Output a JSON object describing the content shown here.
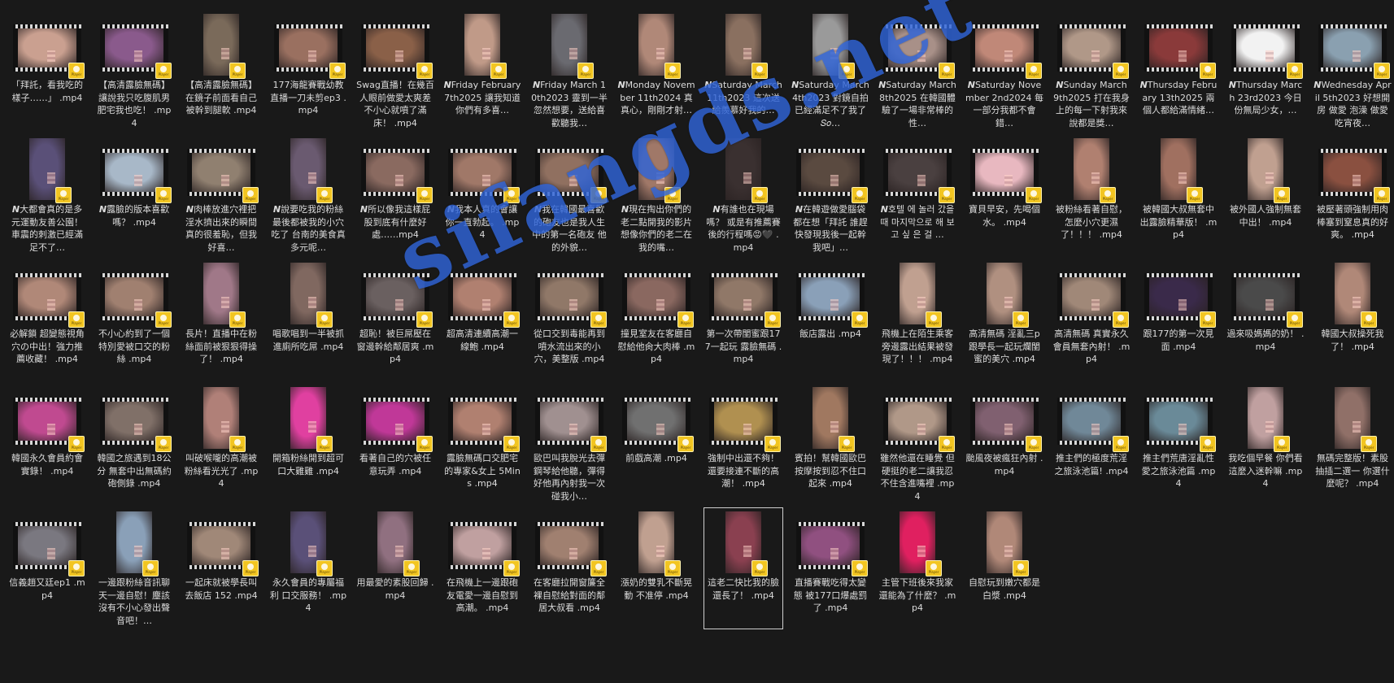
{
  "watermark": "sifangds.net",
  "badge_text": "Player",
  "files": [
    {
      "name": "「拜託，看我吃的樣子……」 .mp4",
      "shape": "land",
      "color": "#caa090"
    },
    {
      "name": "【高清露臉無碼】讓說我只吃腹肌男 肥宅我也吃！ .mp4",
      "shape": "land",
      "color": "#8a5a8c"
    },
    {
      "name": "【高清露臉無碼】在鏡子前面看自己被幹到腿軟 .mp4",
      "shape": "port",
      "color": "#7a6a5a"
    },
    {
      "name": "177海龍賽戰幼教直播一刀未剪ep3 .mp4",
      "shape": "land",
      "color": "#9a7060"
    },
    {
      "name": "Swag直播！在幾百人眼前做愛太爽差不小心就噴了滿床！ .mp4",
      "shape": "land",
      "color": "#8a6048"
    },
    {
      "name": "𝙉Friday February 7th2025 讓我知道你們有多喜…",
      "shape": "port",
      "color": "#c09a88"
    },
    {
      "name": "𝙉Friday March 10th2023 靈到一半忽然想要，送給喜歡聽我…",
      "shape": "port",
      "color": "#6a6a70"
    },
    {
      "name": "𝙉Monday November 11th2024 真真心，剛剛才射…",
      "shape": "port",
      "color": "#b08878"
    },
    {
      "name": "𝙉Saturday March 11th2023 這次送給羨慕好我的…",
      "shape": "port",
      "color": "#8a7060"
    },
    {
      "name": "𝙉Saturday March 4th2023 對鏡自拍已經滿足不了我了 𝑆𝑜…",
      "shape": "port",
      "color": "#9a9a9a"
    },
    {
      "name": "𝙉Saturday March 8th2025 在韓國體驗了一場非常棒的性…",
      "shape": "land",
      "color": "#a89088"
    },
    {
      "name": "𝙉Saturday November 2nd2024 每一部分我都不會錯…",
      "shape": "land",
      "color": "#c08878"
    },
    {
      "name": "𝙉Sunday March 9th2025 打在我身上的每一下射我來說都是獎…",
      "shape": "land",
      "color": "#b09888"
    },
    {
      "name": "𝙉Thursday February 13th2025 兩個人都給滿情緒…",
      "shape": "land",
      "color": "#8a3a3a"
    },
    {
      "name": "𝙉Thursday March 23rd2023 今日份無局少女，…",
      "shape": "land",
      "color": "#f2f2f2"
    },
    {
      "name": "𝙉Wednesday April 5th2023 好想開房 做愛 泡澡 做愛 吃宵夜…",
      "shape": "land",
      "color": "#8aa0b0"
    },
    {
      "name": "𝙉大都會真的是多元運動友善公園！ 車震的刺激已經滿足不了…",
      "shape": "port",
      "color": "#5a5078"
    },
    {
      "name": "𝙉露臉的版本喜歡嗎？ .mp4",
      "shape": "land",
      "color": "#a8b8c8"
    },
    {
      "name": "𝙉肉棒放進穴裡把淫水擠出來的瞬間真的很羞恥，但我好喜…",
      "shape": "land",
      "color": "#908070"
    },
    {
      "name": "𝙉說要吃我的粉絲最後都被我的小穴吃了 台南的美食真多元呢…",
      "shape": "port",
      "color": "#6a5a70"
    },
    {
      "name": "𝙉所以像我這樣屁股到底有什麼好處……mp4",
      "shape": "land",
      "color": "#8a6a60"
    },
    {
      "name": "𝙉我本人真的會讓你一直勃起。 .mp4",
      "shape": "land",
      "color": "#a07868"
    },
    {
      "name": "𝙉我在韓國最喜歡的砲友也是我人生中的第一名砲友 他的外貌…",
      "shape": "land",
      "color": "#907060"
    },
    {
      "name": "𝙉現在掏出你們的老二點開我的影片 想像你們的老二在我的嘴…",
      "shape": "port",
      "color": "#a07868"
    },
    {
      "name": "𝙉有誰也在現場嗎？ 或是有推薦賽後的行程嗎😡🖤 .mp4",
      "shape": "port",
      "color": "#3a3030"
    },
    {
      "name": "𝙉在韓遊做愛腦袋都在想「拜託 誰趕快發現我後一起幹我吧」…",
      "shape": "land",
      "color": "#5a4a40"
    },
    {
      "name": "𝙉호텔 에 놀러 갔을 때 마지막으로 해 보고 싶 은 걸 …",
      "shape": "land",
      "color": "#4a4040"
    },
    {
      "name": "寶貝早安，先喝個水。 .mp4",
      "shape": "land",
      "color": "#e8b8c0"
    },
    {
      "name": "被粉絲看著自慰，怎麼小穴更濕了！！！ .mp4",
      "shape": "port",
      "color": "#b08070"
    },
    {
      "name": "被韓國大叔無套中出露臉精華版！ .mp4",
      "shape": "port",
      "color": "#a07060"
    },
    {
      "name": "被外國人強制無套中出！ .mp4",
      "shape": "port",
      "color": "#c0a090"
    },
    {
      "name": "被壓著頭強制用肉棒塞到窒息真的好爽。 .mp4",
      "shape": "land",
      "color": "#8a5040"
    },
    {
      "name": "必解鎖 超變態視角 穴の中出！強力推薦收藏！ .mp4",
      "shape": "land",
      "color": "#b08878"
    },
    {
      "name": "不小心約到了一個特別愛被口交的粉絲 .mp4",
      "shape": "land",
      "color": "#a08070"
    },
    {
      "name": "長片！直播中在粉絲面前被狠狠得操了！ .mp4",
      "shape": "port",
      "color": "#a07888"
    },
    {
      "name": "唱歌唱到一半被抓進廁所吃屌 .mp4",
      "shape": "port",
      "color": "#806860"
    },
    {
      "name": "超恥！被巨屌壓在窗邊幹給鄰居爽 .mp4",
      "shape": "land",
      "color": "#6a6060"
    },
    {
      "name": "超高清連續高潮一線鮑 .mp4",
      "shape": "land",
      "color": "#b08070"
    },
    {
      "name": "從口交到毒能再到噴水流出來的小穴，美整版 .mp4",
      "shape": "land",
      "color": "#907868"
    },
    {
      "name": "撞見室友在客廳自慰給他肏大肉棒 .mp4",
      "shape": "land",
      "color": "#8a6860"
    },
    {
      "name": "第一次帶閨蜜跟177一起玩 露臉無碼 .mp4",
      "shape": "land",
      "color": "#907868"
    },
    {
      "name": "飯店露出 .mp4",
      "shape": "land",
      "color": "#8aa0b8"
    },
    {
      "name": "飛機上在陌生乘客旁邊露出結果被發現了！！！ .mp4",
      "shape": "port",
      "color": "#c0a090"
    },
    {
      "name": "高清無碼 淫亂三p 跟學長一起玩爛閨蜜的美穴 .mp4",
      "shape": "port",
      "color": "#b09080"
    },
    {
      "name": "高清無碼 真實永久會員無套內射！ .mp4",
      "shape": "land",
      "color": "#a08878"
    },
    {
      "name": "跟177的第一次見面 .mp4",
      "shape": "land",
      "color": "#3a2a4a"
    },
    {
      "name": "過來吸媽媽的奶！ .mp4",
      "shape": "land",
      "color": "#4a4a4a"
    },
    {
      "name": "韓國大叔操死我了！ .mp4",
      "shape": "port",
      "color": "#b08878"
    },
    {
      "name": "韓國永久會員約會實錄！ .mp4",
      "shape": "land",
      "color": "#c04a90"
    },
    {
      "name": "韓國之旅遇到18公分 無套中出無碼約砲側錄 .mp4",
      "shape": "land",
      "color": "#807068"
    },
    {
      "name": "叫破喉嚨的高潮被粉絲看光光了 .mp4",
      "shape": "port",
      "color": "#b08078"
    },
    {
      "name": "開箱粉絲開到超可口大雞雞 .mp4",
      "shape": "port",
      "color": "#e040a0"
    },
    {
      "name": "看著自己的穴被任意玩弄 .mp4",
      "shape": "land",
      "color": "#c03898"
    },
    {
      "name": "露臉無碼口交肥宅的專家&女上 5Mins .mp4",
      "shape": "land",
      "color": "#b08070"
    },
    {
      "name": "歐巴叫我脫光去彈鋼琴給他聽，彈得好他再內射我一次碰我小…",
      "shape": "land",
      "color": "#a09090"
    },
    {
      "name": "前戲高潮 .mp4",
      "shape": "land",
      "color": "#707070"
    },
    {
      "name": "強制中出還不夠！還要接連不斷的高潮！ .mp4",
      "shape": "land",
      "color": "#b09050"
    },
    {
      "name": "賓拍！幫韓國歐巴按摩按到忍不住口起來 .mp4",
      "shape": "port",
      "color": "#a07860"
    },
    {
      "name": "雖然他還在睡覺 但硬挺的老二讓我忍不住含進嘴裡 .mp4",
      "shape": "land",
      "color": "#b09888"
    },
    {
      "name": "颱風夜被瘋狂內射 .mp4",
      "shape": "land",
      "color": "#806070"
    },
    {
      "name": "推主們的極度荒淫之旅泳池篇! .mp4",
      "shape": "land",
      "color": "#708898"
    },
    {
      "name": "推主們荒唐淫亂性愛之旅泳池篇 .mp4",
      "shape": "land",
      "color": "#6a8a98"
    },
    {
      "name": "我吃個早餐 你們看這麼入迷幹嘛 .mp4",
      "shape": "port",
      "color": "#c0a0a0"
    },
    {
      "name": "無碼完整版！素股抽插二選一 你選什麼呢？ .mp4",
      "shape": "port",
      "color": "#907068"
    },
    {
      "name": "信義趙又廷ep1 .mp4",
      "shape": "land",
      "color": "#7a7880"
    },
    {
      "name": "一邊跟粉絲音訊聊天一邊自慰！塵該沒有不小心發出聲音吧！…",
      "shape": "port",
      "color": "#8aa0b8"
    },
    {
      "name": "一起床就被學長叫去飯店 152 .mp4",
      "shape": "land",
      "color": "#a08878"
    },
    {
      "name": "永久會員的專屬福利 口交服務！ .mp4",
      "shape": "port",
      "color": "#5a5078"
    },
    {
      "name": "用最愛的素股回歸 .mp4",
      "shape": "port",
      "color": "#907080"
    },
    {
      "name": "在飛機上一邊跟砲友電愛一邊自慰到高潮。 .mp4",
      "shape": "land",
      "color": "#c0a0a0"
    },
    {
      "name": "在客廳拉開窗簾全裸自慰給對面的鄰居大叔看 .mp4",
      "shape": "land",
      "color": "#a08070"
    },
    {
      "name": "漲奶的雙乳不斷晃動 不准停 .mp4",
      "shape": "port",
      "color": "#c0a090"
    },
    {
      "name": "這老二快比我的臉還長了！ .mp4",
      "shape": "port",
      "color": "#8a4050",
      "selected": true
    },
    {
      "name": "直播賽戰吃得太變態 被177口爆處罰了 .mp4",
      "shape": "land",
      "color": "#905080"
    },
    {
      "name": "主管下班後來我家還能為了什麼？ .mp4",
      "shape": "port",
      "color": "#e02060"
    },
    {
      "name": "自慰玩到嫩穴都是白漿 .mp4",
      "shape": "port",
      "color": "#b08878"
    }
  ]
}
